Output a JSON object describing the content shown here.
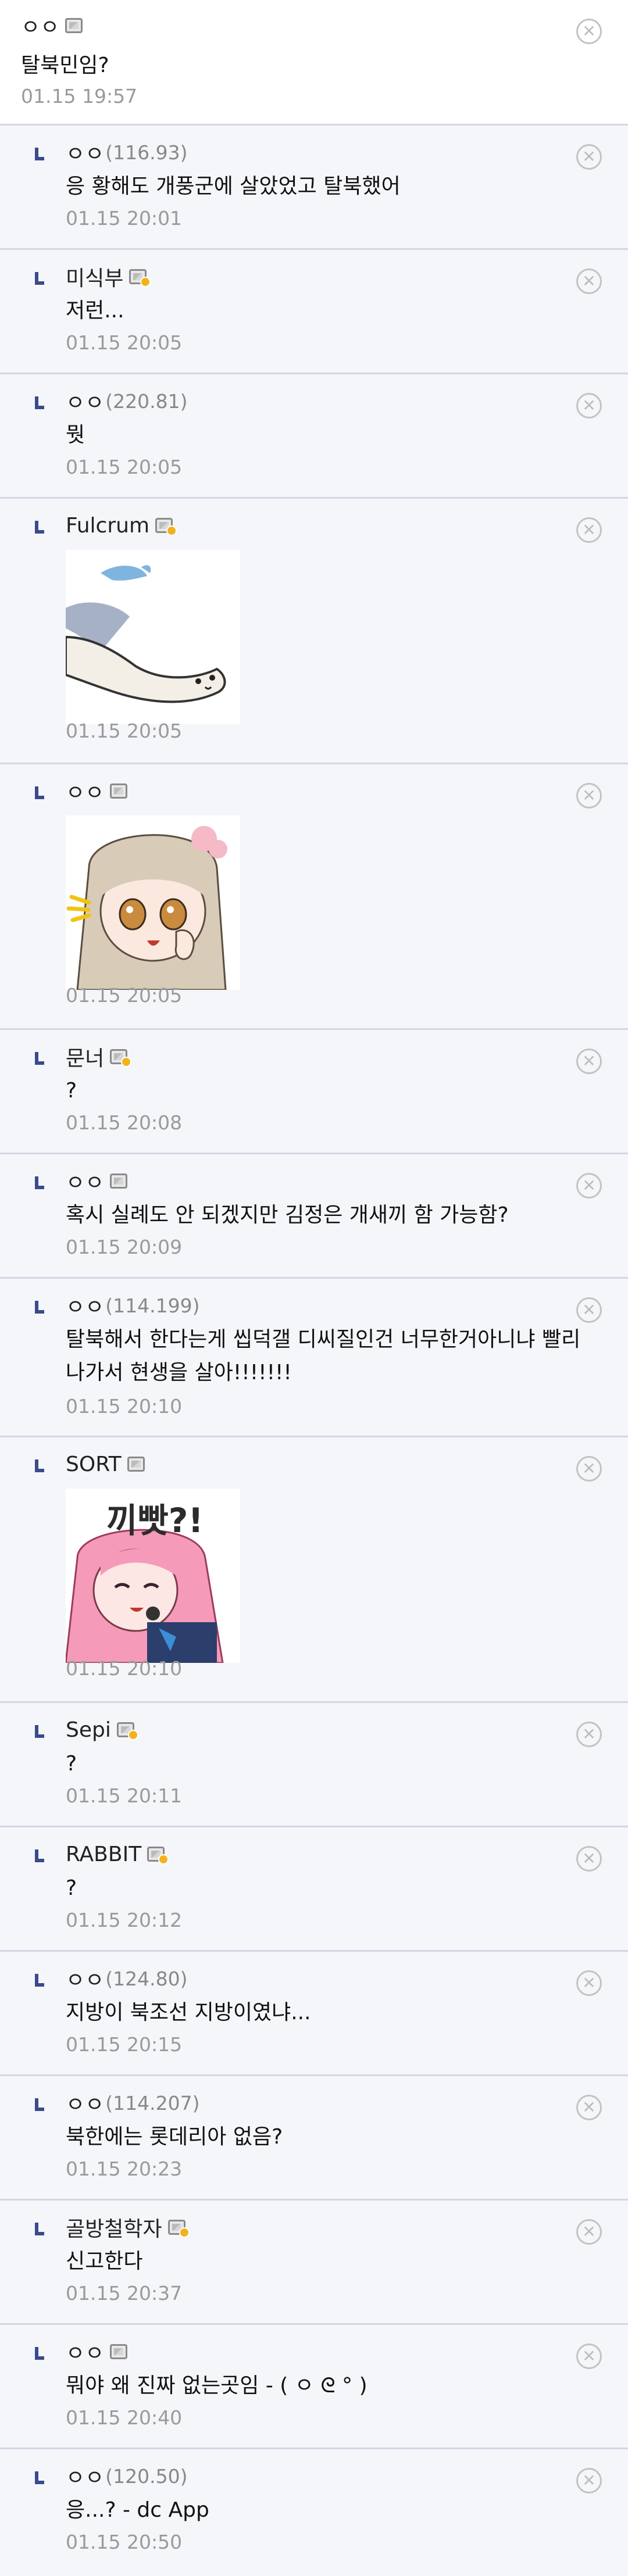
{
  "comments": [
    {
      "nick": "ㅇㅇ",
      "ip": "",
      "badge": "plain",
      "text": "탈북민임?",
      "date": "01.15 19:57",
      "top": true
    },
    {
      "nick": "ㅇㅇ",
      "ip": "(116.93)",
      "badge": "",
      "text": "응 황해도 개풍군에 살았었고 탈북했어",
      "date": "01.15 20:01"
    },
    {
      "nick": "미식부",
      "ip": "",
      "badge": "fixed",
      "text": "저런...",
      "date": "01.15 20:05"
    },
    {
      "nick": "ㅇㅇ",
      "ip": "(220.81)",
      "badge": "",
      "text": "뭣",
      "date": "01.15 20:05"
    },
    {
      "nick": "Fulcrum",
      "ip": "",
      "badge": "fixed",
      "sticker": "seal-sticker",
      "date": "01.15 20:05"
    },
    {
      "nick": "ㅇㅇ",
      "ip": "",
      "badge": "plain",
      "sticker": "anime-girl-sticker",
      "date": "01.15 20:05"
    },
    {
      "nick": "문너",
      "ip": "",
      "badge": "fixed",
      "text": "?",
      "date": "01.15 20:08"
    },
    {
      "nick": "ㅇㅇ",
      "ip": "",
      "badge": "plain",
      "text": "혹시 실례도 안 되겠지만 김정은 개새끼 함 가능함?",
      "date": "01.15 20:09"
    },
    {
      "nick": "ㅇㅇ",
      "ip": "(114.199)",
      "badge": "",
      "text_lines": [
        "탈북해서 한다는게 씹덕갤 디씨질인건 너무한거아니냐 빨리",
        "나가서 현생을 살아!!!!!!!"
      ],
      "date": "01.15 20:10"
    },
    {
      "nick": "SORT",
      "ip": "",
      "badge": "plain",
      "sticker": "pink-hair-girl-sticker",
      "sticker_text": "끼빳?!",
      "date": "01.15 20:10"
    },
    {
      "nick": "Sepi",
      "ip": "",
      "badge": "fixed",
      "text": "?",
      "date": "01.15 20:11"
    },
    {
      "nick": "RABBIT",
      "ip": "",
      "badge": "fixed",
      "text": "?",
      "date": "01.15 20:12"
    },
    {
      "nick": "ㅇㅇ",
      "ip": "(124.80)",
      "badge": "",
      "text": "지방이 북조선 지방이였냐...",
      "date": "01.15 20:15"
    },
    {
      "nick": "ㅇㅇ",
      "ip": "(114.207)",
      "badge": "",
      "text": "북한에는 롯데리아 없음?",
      "date": "01.15 20:23"
    },
    {
      "nick": "골방철학자",
      "ip": "",
      "badge": "fixed",
      "text": "신고한다",
      "date": "01.15 20:37"
    },
    {
      "nick": "ㅇㅇ",
      "ip": "",
      "badge": "plain",
      "text": "뭐야 왜 진짜 없는곳임 - ( ㅇ ᘓ ° )",
      "date": "01.15 20:40"
    },
    {
      "nick": "ㅇㅇ",
      "ip": "(120.50)",
      "badge": "",
      "text": "응...? - dc App",
      "date": "01.15 20:50"
    }
  ],
  "delete_icon": "x-circle-icon"
}
